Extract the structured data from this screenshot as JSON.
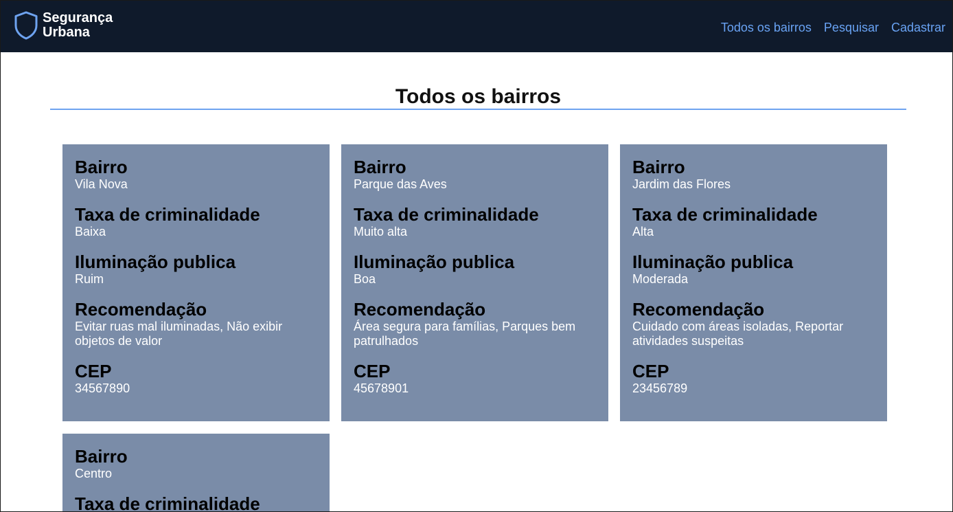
{
  "brand": {
    "line1": "Segurança",
    "line2": "Urbana"
  },
  "nav": {
    "all": "Todos os bairros",
    "search": "Pesquisar",
    "register": "Cadastrar"
  },
  "page": {
    "title": "Todos os bairros"
  },
  "labels": {
    "bairro": "Bairro",
    "taxa": "Taxa de criminalidade",
    "iluminacao": "Iluminação publica",
    "recomendacao": "Recomendação",
    "cep": "CEP"
  },
  "cards": [
    {
      "bairro": "Vila Nova",
      "taxa": "Baixa",
      "iluminacao": "Ruim",
      "recomendacao": "Evitar ruas mal iluminadas, Não exibir objetos de valor",
      "cep": "34567890"
    },
    {
      "bairro": "Parque das Aves",
      "taxa": "Muito alta",
      "iluminacao": "Boa",
      "recomendacao": "Área segura para famílias, Parques bem patrulhados",
      "cep": "45678901"
    },
    {
      "bairro": "Jardim das Flores",
      "taxa": "Alta",
      "iluminacao": "Moderada",
      "recomendacao": "Cuidado com áreas isoladas, Reportar atividades suspeitas",
      "cep": "23456789"
    },
    {
      "bairro": "Centro"
    }
  ]
}
